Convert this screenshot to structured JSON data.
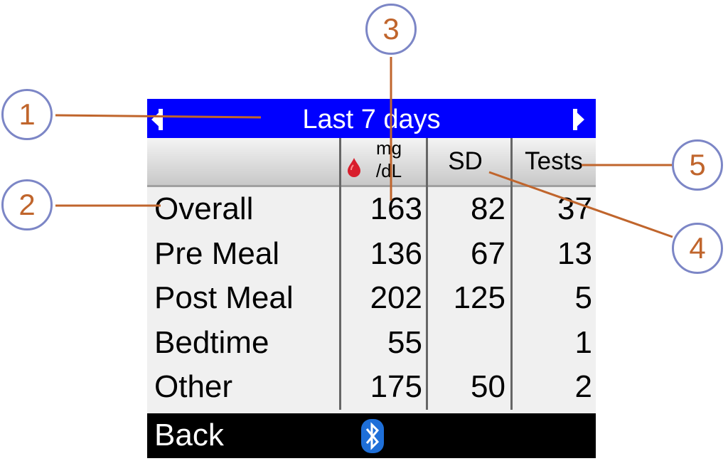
{
  "titlebar": {
    "title": "Last 7 days"
  },
  "header": {
    "unit_top": "mg",
    "unit_bottom": "/dL",
    "sd_label": "SD",
    "tests_label": "Tests"
  },
  "rows": [
    {
      "label": "Overall",
      "mean": "163",
      "sd": "82",
      "tests": "37"
    },
    {
      "label": "Pre Meal",
      "mean": "136",
      "sd": "67",
      "tests": "13"
    },
    {
      "label": "Post Meal",
      "mean": "202",
      "sd": "125",
      "tests": "5"
    },
    {
      "label": "Bedtime",
      "mean": "55",
      "sd": "",
      "tests": "1"
    },
    {
      "label": "Other",
      "mean": "175",
      "sd": "50",
      "tests": "2"
    }
  ],
  "bottombar": {
    "back_label": "Back",
    "icon": "bluetooth-icon"
  },
  "callouts": [
    "1",
    "2",
    "3",
    "4",
    "5"
  ],
  "colors": {
    "title_bg": "#0000ff",
    "callout_text": "#c0652c",
    "callout_border": "#7c86c6",
    "drop": "#d81e2c",
    "bluetooth": "#1e6fd8"
  }
}
